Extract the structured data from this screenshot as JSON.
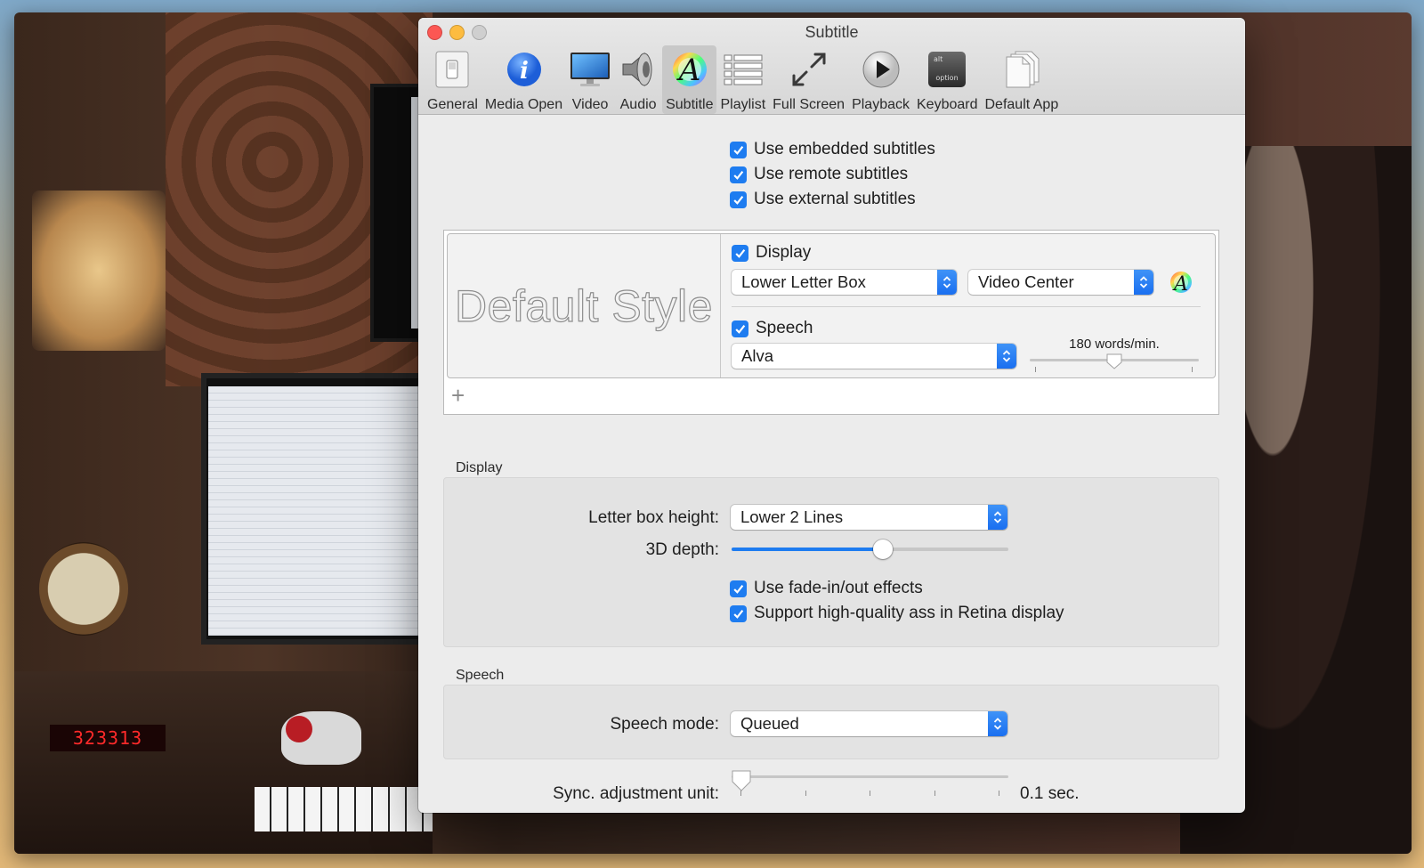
{
  "window": {
    "title": "Subtitle"
  },
  "toolbar": {
    "items": [
      {
        "label": "General",
        "icon": "switch-icon"
      },
      {
        "label": "Media Open",
        "icon": "info-icon"
      },
      {
        "label": "Video",
        "icon": "monitor-icon"
      },
      {
        "label": "Audio",
        "icon": "speaker-icon"
      },
      {
        "label": "Subtitle",
        "icon": "subtitle-a-icon"
      },
      {
        "label": "Playlist",
        "icon": "list-icon"
      },
      {
        "label": "Full Screen",
        "icon": "expand-arrows-icon"
      },
      {
        "label": "Playback",
        "icon": "play-icon"
      },
      {
        "label": "Keyboard",
        "icon": "keyboard-key-icon",
        "key_top": "alt",
        "key_bottom": "option"
      },
      {
        "label": "Default App",
        "icon": "documents-icon"
      }
    ],
    "active_index": 4
  },
  "subtitles": {
    "use_embedded": "Use embedded subtitles",
    "use_remote": "Use remote subtitles",
    "use_external": "Use external subtitles"
  },
  "style": {
    "preview_text": "Default Style",
    "display_label": "Display",
    "position_value": "Lower Letter Box",
    "align_value": "Video Center",
    "speech_label": "Speech",
    "voice_value": "Alva",
    "rate_label": "180 words/min.",
    "rate_level": 0.5,
    "add_symbol": "+"
  },
  "display_section": {
    "title": "Display",
    "letterbox_label": "Letter box height:",
    "letterbox_value": "Lower 2 Lines",
    "depth_label": "3D depth:",
    "depth_level": 0.55,
    "fade_label": "Use fade-in/out effects",
    "hq_label": "Support high-quality ass in Retina display"
  },
  "speech_section": {
    "title": "Speech",
    "mode_label": "Speech mode:",
    "mode_value": "Queued"
  },
  "sync": {
    "label": "Sync. adjustment unit:",
    "value": "0.1 sec.",
    "level": 0
  },
  "desktop": {
    "led_readout": "323313"
  },
  "colors": {
    "accent": "#1e7cf0",
    "close": "#fc5753",
    "minimize": "#fdbc40"
  }
}
